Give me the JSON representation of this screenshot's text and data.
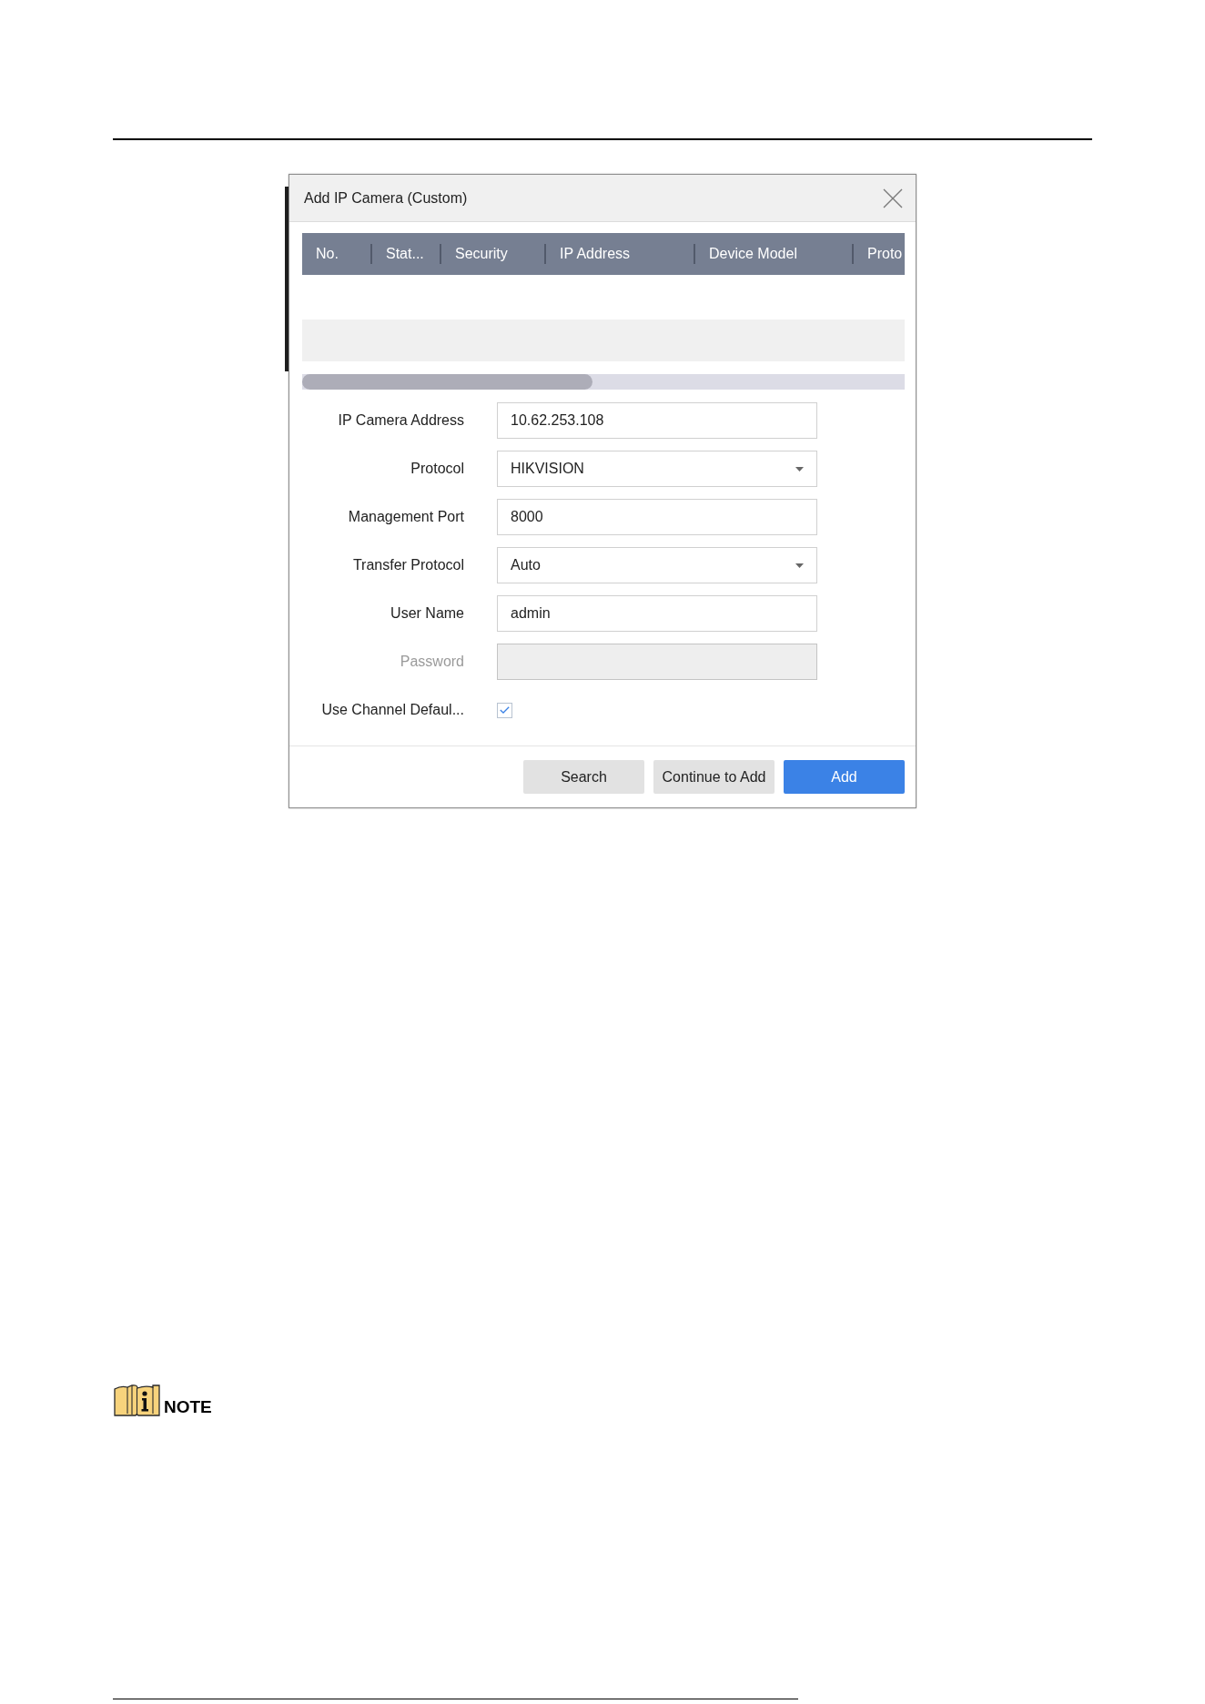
{
  "dialog": {
    "title": "Add IP Camera (Custom)",
    "table": {
      "columns": [
        "No.",
        "Stat...",
        "Security",
        "IP Address",
        "Device Model",
        "Proto"
      ]
    },
    "fields": [
      {
        "label": "IP Camera Address",
        "kind": "text",
        "value": "10.62.253.108",
        "disabled": false
      },
      {
        "label": "Protocol",
        "kind": "select",
        "value": "HIKVISION",
        "disabled": false
      },
      {
        "label": "Management Port",
        "kind": "text",
        "value": "8000",
        "disabled": false
      },
      {
        "label": "Transfer Protocol",
        "kind": "select",
        "value": "Auto",
        "disabled": false
      },
      {
        "label": "User Name",
        "kind": "text",
        "value": "admin",
        "disabled": false
      },
      {
        "label": "Password",
        "kind": "text",
        "disabled": true
      },
      {
        "label": "Use Channel Defaul...",
        "kind": "checkbox",
        "checked": true,
        "disabled": false
      }
    ],
    "buttons": [
      {
        "label": "Search",
        "primary": false
      },
      {
        "label": "Continue to Add",
        "primary": false
      },
      {
        "label": "Add",
        "primary": true
      }
    ]
  },
  "note": {
    "label": "NOTE"
  }
}
